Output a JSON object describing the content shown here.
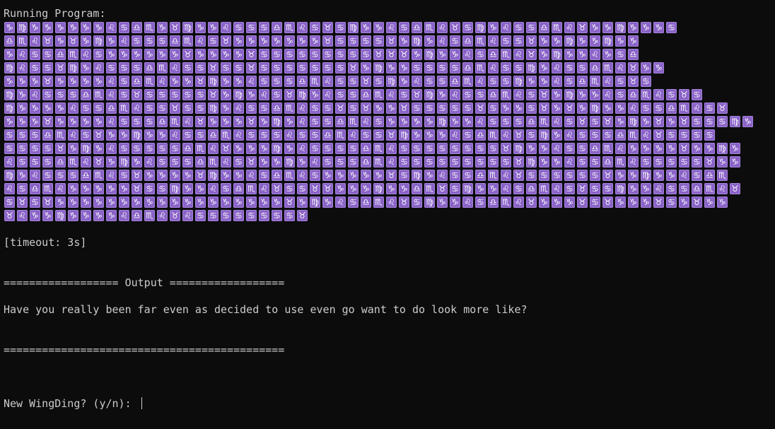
{
  "terminal": {
    "running_label": "Running Program:",
    "glyph_rows": [
      "♑♍♑♑♑♑♑♑♌♋♎♏♑♉♍♑♑♌♋♋♋♎♏♌♋♉♋♍♑♑♌♋♎♏♌♉♋♍♑♌♋♋♎♏♌♉♑♑♍♑♑♑♋",
      "♎♏♌♉♑♉♑♍♑♌♋♋♋♎♏♌♋♉♑♑♑♑♑♑♑♉♋♋♋♋♉♑♍♑♌♋♎♏♌♋♋♉♑♑♍♑♑♍♑♑",
      "♑♌♋♋♎♏♌♋♑♑♑♑♑♑♉♑♑♑♑♉♋♋♋♋♋♋♋♋♋♉♉♉♑♍♑♑♌♋♎♏♌♉♑♍♑♑♌♑♋♎",
      "♍♌♋♋♉♍♑♌♋♋♋♎♏♌♋♋♉♋♋♉♋♋♋♋♋♋♋♉♑♍♑♑♋♋♋♋♎♏♌♋♋♍♑♌♋♋♎♏♌♉♑♑",
      "♑♑♑♉♑♑♑♑♌♋♎♏♌♑♑♉♍♑♑♌♋♋♋♎♏♌♋♋♉♋♍♑♌♋♋♎♏♌♋♋♍♑♑♌♋♎♏♌♋♉♋",
      "♍♑♌♋♋♋♎♏♌♋♉♋♋♋♋♋♉♑♍♑♌♋♉♍♑♌♋♋♎♏♌♋♉♍♑♌♋♋♎♏♌♋♉♑♍♑♑♌♋♎♏♌♋♉♋",
      "♍♑♑♑♑♌♋♋♎♏♌♋♋♉♋♋♍♑♌♋♋♎♏♌♋♋♉♋♉♑♑♉♋♋♋♋♋♉♋♑♑♋♉♑♉♑♍♑♑♌♋♋♎♏♌♋♉",
      "♑♑♑♉♑♑♑♑♌♋♋♋♎♏♌♉♑♑♑♉♑♍♑♌♋♋♎♏♌♋♑♑♑♑♍♑♑♌♋♋♋♎♏♌♋♉♋♉♑♍♑♉♑♉♋♋♋♍♑",
      "♋♋♋♎♏♌♋♉♑♑♍♑♑♌♋♋♎♏♌♋♋♋♌♋♋♎♏♌♋♋♉♍♑♑♑♌♋♎♏♌♉♋♍♑♌♋♋♋♎♏♌♉♋♋♋♋",
      "♋♋♋♋♉♑♍♑♌♋♋♋♋♋♎♏♌♉♑♑♑♍♑♌♋♋♋♋♎♏♌♋♋♋♋♋♋♋♋♉♍♑♑♌♋♋♎♏♌♑♑♑♑♉♑♑♍♑",
      "♌♋♋♋♎♏♌♉♑♍♑♌♋♋♋♎♏♌♋♉♑♑♍♑♌♋♋♋♎♏♌♋♋♋♋♋♋♋♋♋♉♍♑♑♌♋♋♎♏♌♋♋♋♋♋♉♑♑",
      "♍♑♌♋♋♋♎♏♌♋♉♑♑♑♑♉♍♑♑♌♋♎♏♌♋♑♑♑♑♑♉♋♍♑♌♋♋♎♏♌♉♋♋♋♋♋♋♉♑♑♍♑♑♌♋♎♏",
      "♌♋♎♏♌♑♑♑♑♑♉♋♋♍♑♑♌♋♎♏♌♉♋♋♉♉♑♑♑♍♑♑♎♏♉♋♍♑♑♌♋♎♏♌♋♉♋♋♍♑♑♌♋♋♎♏♌♉",
      "♋♉♋♉♑♑♑♑♑♑♑♑♑♑♑♑♑♑♑♑♑♑♉♑♍♑♌♋♎♏♌♉♋♍♑♑♌♋♎♏♌♉♑♑♑♉♋♉♑♑♑♉♋♑♉♑♑",
      "♉♌♑♑♍♑♑♑♑♌♎♏♌♉♌♋♋♋♋♋♋♋♋♉"
    ],
    "timeout_text": "[timeout: 3s]",
    "output_header": "================== Output ==================",
    "output_text": "Have you really been far even as decided to use even go want to do look more like?",
    "output_footer": "============================================",
    "prompt_text": "New WingDing? (y/n): ",
    "colors": {
      "background": "#0c0c0c",
      "text": "#cccccc",
      "glyph_bg": "#8a63c8"
    }
  }
}
